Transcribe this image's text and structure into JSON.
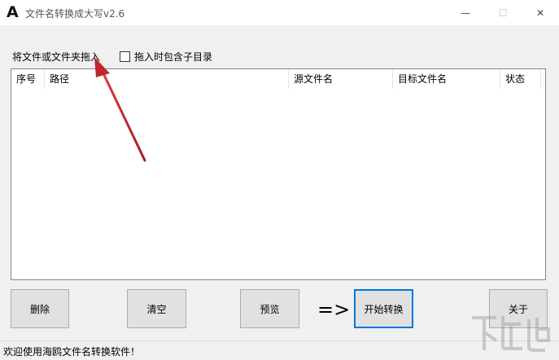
{
  "window": {
    "app_icon_letter": "A",
    "title": "文件名转换成大写v2.6",
    "minimize_glyph": "—",
    "maximize_glyph": "☐",
    "close_glyph": "✕"
  },
  "drop_label": "将文件或文件夹拖入",
  "include_subdirs": {
    "label": "拖入时包含子目录",
    "checked": false
  },
  "list": {
    "columns": [
      "序号",
      "路径",
      "源文件名",
      "目标文件名",
      "状态"
    ],
    "rows": []
  },
  "buttons": {
    "delete": "删除",
    "clear": "清空",
    "preview": "预览",
    "arrow": "=>",
    "start": "开始转换",
    "about": "关于"
  },
  "status_text": "欢迎使用海鸥文件名转换软件！",
  "watermark_text": "下载吧",
  "colors": {
    "accent_border": "#0078d7",
    "annotation_arrow": "#c0272d"
  }
}
